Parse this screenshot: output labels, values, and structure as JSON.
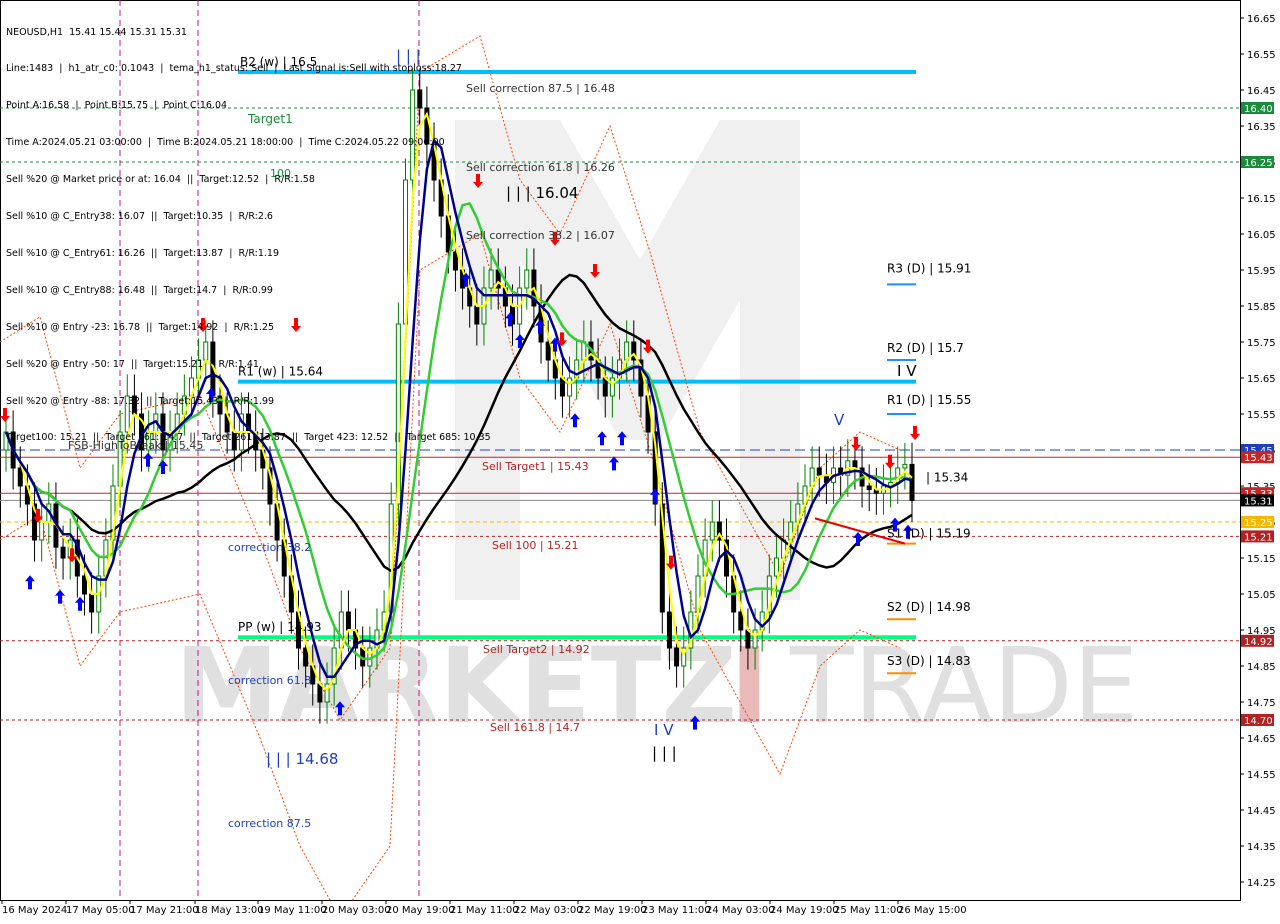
{
  "header": {
    "title": "NEOUSD,H1  15.41 15.44 15.31 15.31",
    "lines": [
      "Line:1483  |  h1_atr_c0: 0.1043  |  tema_h1_status: Sell  |  Last Signal is:Sell with stoploss:18.27",
      "Point A:16.58  |  Point B:15.75  |  Point C:16.04",
      "Time A:2024.05.21 03:00:00  |  Time B:2024.05.21 18:00:00  |  Time C:2024.05.22 09:00:00",
      "Sell %20 @ Market price or at: 16.04  ||  Target:12.52  |  R/R:1.58",
      "Sell %10 @ C_Entry38: 16.07  ||  Target:10.35  |  R/R:2.6",
      "Sell %10 @ C_Entry61: 16.26  ||  Target:13.87  |  R/R:1.19",
      "Sell %10 @ C_Entry88: 16.48  ||  Target:14.7  |  R/R:0.99",
      "Sell %10 @ Entry -23: 16.78  ||  Target:14.92  |  R/R:1.25",
      "Sell %20 @ Entry -50: 17  ||  Target:15.21  |  R/R:1.41",
      "Sell %20 @ Entry -88: 17.32  ||  Target:15.43  |  R/R:1.99",
      "Target100: 15.21  ||  Target 161: 14.7  ||  Target 261: 13.87  ||  Target 423: 12.52  ||  Target 685: 10.35"
    ]
  },
  "watermark": {
    "text_left": "MARKETZ",
    "text_i": "I",
    "text_right": "TRADE"
  },
  "colors": {
    "bull_candle": "#008000",
    "bear_candle": "#000000",
    "ma_black": "#000000",
    "ma_navy": "#00008b",
    "ma_yellow": "#ffff00",
    "ma_green": "#32cd32",
    "level_cyan": "#00bfff",
    "level_green": "#00ff7f",
    "sell_red": "#b22222",
    "magenta": "#c71585",
    "up_arrow": "#0000ff",
    "down_arrow": "#ff0000",
    "envelope": "#ff4500"
  },
  "chart_data": {
    "type": "candlestick",
    "symbol": "NEOUSD",
    "timeframe": "H1",
    "ohlc_last": {
      "open": 15.41,
      "high": 15.44,
      "low": 15.31,
      "close": 15.31
    },
    "y_axis": {
      "min": 14.2,
      "max": 16.7,
      "side": "right",
      "ticks": [
        "16.65",
        "16.55",
        "16.45",
        "16.35",
        "16.25",
        "16.15",
        "16.05",
        "15.95",
        "15.85",
        "15.75",
        "15.65",
        "15.55",
        "15.45",
        "15.35",
        "15.25",
        "15.15",
        "15.05",
        "14.95",
        "14.85",
        "14.75",
        "14.65",
        "14.55",
        "14.45",
        "14.35",
        "14.25"
      ]
    },
    "x_axis": {
      "labels": [
        "16 May 2024",
        "17 May 05:00",
        "17 May 21:00",
        "18 May 13:00",
        "19 May 11:00",
        "20 May 03:00",
        "20 May 19:00",
        "21 May 11:00",
        "22 May 03:00",
        "22 May 19:00",
        "23 May 11:00",
        "24 May 03:00",
        "24 May 19:00",
        "25 May 11:00",
        "26 May 15:00"
      ]
    },
    "price_badges": [
      {
        "value": "16.40",
        "color": "#1b8a3a"
      },
      {
        "value": "16.25",
        "color": "#1b8a3a"
      },
      {
        "value": "15.45",
        "color": "#1f3fbf"
      },
      {
        "value": "15.43",
        "color": "#cc2222"
      },
      {
        "value": "15.33",
        "color": "#cc2222"
      },
      {
        "value": "15.31",
        "color": "#000000"
      },
      {
        "value": "15.25",
        "color": "#f5b800"
      },
      {
        "value": "15.21",
        "color": "#b22222"
      },
      {
        "value": "14.92",
        "color": "#b22222"
      },
      {
        "value": "14.70",
        "color": "#b22222"
      }
    ],
    "levels": [
      {
        "name": "B2 (w)",
        "price": 16.5,
        "label": "B2 (w) | 16.5"
      },
      {
        "name": "R1 (w)",
        "price": 15.64,
        "label": "R1 (w) | 15.64"
      },
      {
        "name": "PP (w)",
        "price": 14.93,
        "label": "PP (w) | 14.93"
      },
      {
        "name": "R3 (D)",
        "price": 15.91,
        "label": "R3 (D) | 15.91"
      },
      {
        "name": "R2 (D)",
        "price": 15.7,
        "label": "R2 (D) | 15.7"
      },
      {
        "name": "R1 (D)",
        "price": 15.55,
        "label": "R1 (D) | 15.55"
      },
      {
        "name": "PP (D)",
        "price": 15.34,
        "label": "| 15.34"
      },
      {
        "name": "S1 (D)",
        "price": 15.19,
        "label": "S1 (D) | 15.19"
      },
      {
        "name": "S2 (D)",
        "price": 14.98,
        "label": "S2 (D) | 14.98"
      },
      {
        "name": "S3 (D)",
        "price": 14.83,
        "label": "S3 (D) | 14.83"
      }
    ],
    "annotations": [
      "Sell correction 87.5 | 16.48",
      "Sell correction 61.8 | 16.26",
      "Sell correction 38.2 | 16.07",
      "| | | 16.04",
      "Sell Target1 | 15.43",
      "Sell 100 | 15.21",
      "Sell Target2 | 14.92",
      "Sell 161.8 | 14.7",
      "FSB-HighToBreak | 15.45",
      "correction 38.2",
      "correction 61.8",
      "correction 87.5",
      "| | | 14.68",
      "Target1",
      "100",
      "| | |",
      "I V",
      "| | |",
      "V",
      "I V"
    ],
    "series": [
      {
        "name": "close",
        "values": [
          15.5,
          15.4,
          15.35,
          15.3,
          15.2,
          15.25,
          15.3,
          15.18,
          15.15,
          15.2,
          15.1,
          15.05,
          15.0,
          15.1,
          15.2,
          15.35,
          15.5,
          15.6,
          15.55,
          15.45,
          15.5,
          15.55,
          15.45,
          15.5,
          15.55,
          15.6,
          15.65,
          15.7,
          15.75,
          15.6,
          15.55,
          15.5,
          15.45,
          15.55,
          15.5,
          15.45,
          15.4,
          15.3,
          15.2,
          15.1,
          15.0,
          14.9,
          14.85,
          14.8,
          14.75,
          14.8,
          14.9,
          15.0,
          14.95,
          14.9,
          14.85,
          14.9,
          14.95,
          15.0,
          15.3,
          15.8,
          16.2,
          16.45,
          16.4,
          16.3,
          16.2,
          16.1,
          16.0,
          15.95,
          15.9,
          15.85,
          15.8,
          15.9,
          15.95,
          15.9,
          15.85,
          15.8,
          15.9,
          15.95,
          15.85,
          15.75,
          15.7,
          15.65,
          15.6,
          15.65,
          15.7,
          15.75,
          15.7,
          15.65,
          15.6,
          15.65,
          15.7,
          15.75,
          15.7,
          15.6,
          15.5,
          15.3,
          15.0,
          14.9,
          14.85,
          14.9,
          15.0,
          15.1,
          15.2,
          15.25,
          15.2,
          15.1,
          15.0,
          14.95,
          14.9,
          14.95,
          15.0,
          15.1,
          15.15,
          15.2,
          15.25,
          15.3,
          15.35,
          15.4,
          15.38,
          15.36,
          15.4,
          15.38,
          15.42,
          15.4,
          15.35,
          15.34,
          15.33,
          15.35,
          15.36,
          15.4,
          15.41,
          15.31
        ]
      }
    ]
  }
}
